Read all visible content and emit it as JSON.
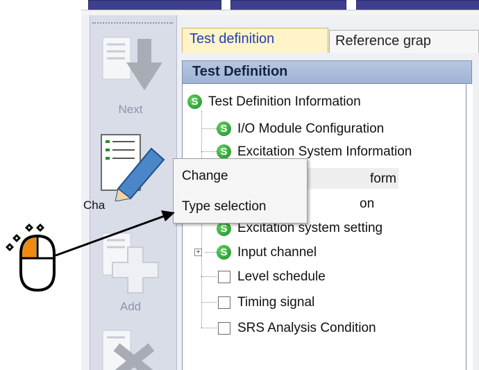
{
  "toolbar": {
    "buttons": [
      {
        "label": "Next"
      },
      {
        "label": "Cha"
      },
      {
        "label": "Add"
      }
    ]
  },
  "tabs": [
    {
      "label": "Test definition",
      "active": true
    },
    {
      "label": "Reference grap",
      "active": false
    }
  ],
  "panel": {
    "title": "Test Definition"
  },
  "tree": [
    {
      "label": "Test Definition Information",
      "icon": "s-badge"
    },
    {
      "label": "I/O Module Configuration",
      "icon": "s-badge"
    },
    {
      "label": "Excitation System Information",
      "icon": "s-badge"
    },
    {
      "label": "form",
      "icon": "s-badge"
    },
    {
      "label": "on",
      "icon": "s-badge"
    },
    {
      "label": "Excitation system setting",
      "icon": "s-badge"
    },
    {
      "label": "Input channel",
      "icon": "s-badge"
    },
    {
      "label": "Level schedule",
      "icon": "checkbox"
    },
    {
      "label": "Timing signal",
      "icon": "checkbox"
    },
    {
      "label": "SRS Analysis Condition",
      "icon": "checkbox"
    }
  ],
  "context_menu": {
    "items": [
      {
        "label": "Change"
      },
      {
        "label": "Type selection"
      }
    ]
  },
  "colors": {
    "accent_mouse_button": "#f08a10",
    "tab_active": "#fff4c8",
    "s_badge": "#1f8a2a"
  }
}
